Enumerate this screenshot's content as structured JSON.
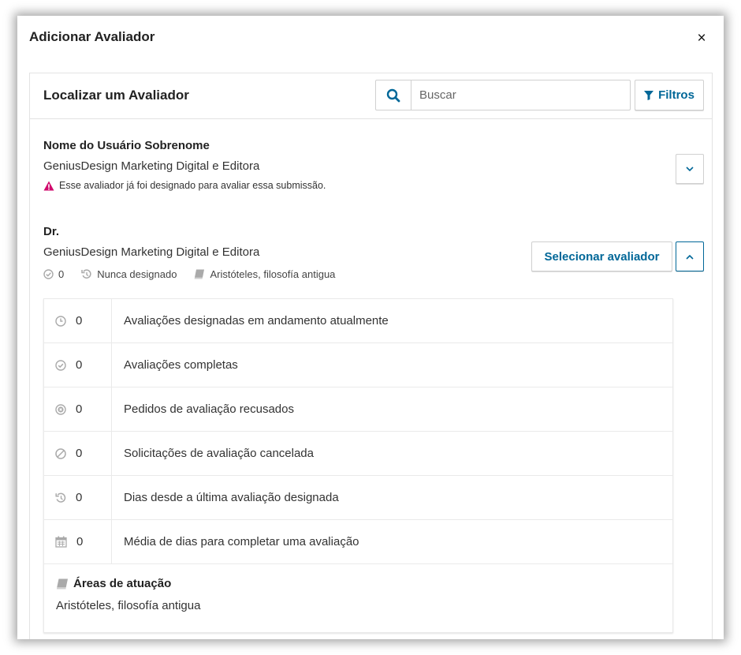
{
  "modal": {
    "title": "Adicionar Avaliador",
    "close_label": "×"
  },
  "panel": {
    "title": "Localizar um Avaliador",
    "search": {
      "placeholder": "Buscar",
      "value": ""
    },
    "filters_label": "Filtros"
  },
  "reviewers": [
    {
      "name": "Nome do Usuário Sobrenome",
      "affiliation": "GeniusDesign Marketing Digital e Editora",
      "warning": "Esse avaliador já foi designado para avaliar essa submissão."
    },
    {
      "name": "Dr.",
      "affiliation": "GeniusDesign Marketing Digital e Editora",
      "select_label": "Selecionar avaliador",
      "meta": {
        "completed": "0",
        "last_assigned": "Nunca designado",
        "interests": "Aristóteles, filosofía antigua"
      },
      "stats": [
        {
          "icon": "clock-icon",
          "value": "0",
          "label": "Avaliações designadas em andamento atualmente"
        },
        {
          "icon": "check-circle-icon",
          "value": "0",
          "label": "Avaliações completas"
        },
        {
          "icon": "times-circle-icon",
          "value": "0",
          "label": "Pedidos de avaliação recusados"
        },
        {
          "icon": "ban-icon",
          "value": "0",
          "label": "Solicitações de avaliação cancelada"
        },
        {
          "icon": "history-icon",
          "value": "0",
          "label": "Dias desde a última avaliação designada"
        },
        {
          "icon": "calendar-icon",
          "value": "0",
          "label": "Média de dias para completar uma avaliação"
        }
      ],
      "areas_title": "Áreas de atuação",
      "areas_text": "Aristóteles, filosofía antigua"
    }
  ],
  "colors": {
    "accent": "#006798",
    "warning": "#d00a6c",
    "icon": "#aaaaaa"
  }
}
